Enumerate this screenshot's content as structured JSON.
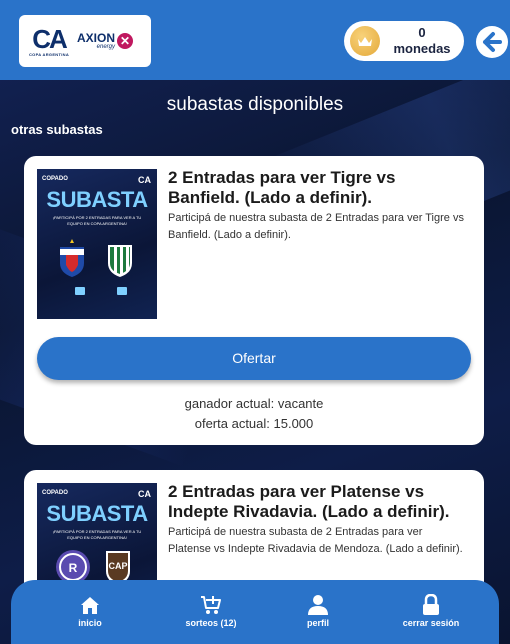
{
  "header": {
    "brand_ca": "CA",
    "brand_ca_sub": "COPA ARGENTINA",
    "brand_axion": "AXION",
    "brand_energy": "energy",
    "coins_count": "0",
    "coins_label": "monedas"
  },
  "page": {
    "title": "subastas disponibles",
    "section_label": "otras subastas"
  },
  "auctions": [
    {
      "poster_top": "COPADO",
      "poster_ca": "CA",
      "poster_title": "SUBASTA",
      "poster_text": "¡PARTICIPÁ POR 2 ENTRADAS PARA VER A TU EQUIPO EN COPA ARGENTINA!",
      "title": "2 Entradas para ver Tigre vs Banfield. (Lado a definir).",
      "description": "Participá de nuestra subasta de 2 Entradas para ver Tigre vs Banfield. (Lado a definir).",
      "button_label": "Ofertar",
      "winner": "ganador actual: vacante",
      "offer": "oferta actual: 15.000"
    },
    {
      "poster_top": "COPADO",
      "poster_ca": "CA",
      "poster_title": "SUBASTA",
      "poster_text": "¡PARTICIPÁ POR 2 ENTRADAS PARA VER A TU EQUIPO EN COPA ARGENTINA!",
      "title": "2 Entradas para ver Platense vs Indepte Rivadavia. (Lado a definir).",
      "description": "Participá de nuestra subasta de 2 Entradas para ver Platense vs Indepte Rivadavia de Mendoza. (Lado a definir)."
    }
  ],
  "nav": {
    "items": [
      {
        "label": "inicio",
        "icon": "home-icon"
      },
      {
        "label": "sorteos (12)",
        "icon": "cart-plus-icon"
      },
      {
        "label": "perfil",
        "icon": "user-icon"
      },
      {
        "label": "cerrar sesión",
        "icon": "lock-icon"
      }
    ]
  },
  "colors": {
    "primary": "#2a73c9",
    "background": "#0d1a3a",
    "card": "#ffffff"
  }
}
